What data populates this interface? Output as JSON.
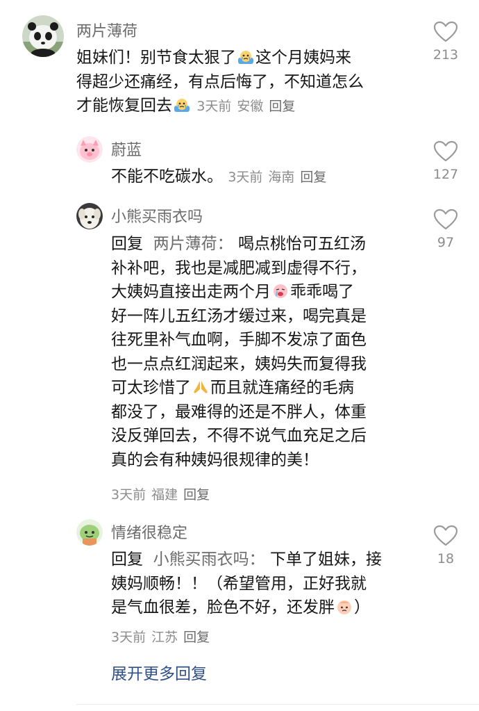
{
  "comments": [
    {
      "username": "两片薄荷",
      "avatar": "panda-avatar",
      "lines": [
        "姐妹们！别节食太狠了",
        "这个月姨妈来",
        "得超少还痛经，有点后悔了，不知道怎么",
        "才能恢复回去"
      ],
      "time": "3天前",
      "location": "安徽",
      "reply_label": "回复",
      "likes": "213"
    },
    {
      "username": "蔚蓝",
      "avatar": "cartoon-pig-avatar",
      "text": "不能不吃碳水。",
      "time": "3天前",
      "location": "海南",
      "reply_label": "回复",
      "likes": "127"
    },
    {
      "username": "小熊买雨衣吗",
      "avatar": "white-dog-avatar",
      "reply_prefix": "回复",
      "reply_target": "两片薄荷：",
      "lines": [
        "喝点桃怡可五红汤",
        "补补吧，我也是减肥减到虚得不行，",
        "大姨妈直接出走两个月",
        "乖乖喝了",
        "好一阵儿五红汤才缓过来，喝完真是",
        "往死里补气血啊，手脚不发凉了面色",
        "也一点点红润起来，姨妈失而复得我",
        "可太珍惜了",
        "而且就连痛经的毛病",
        "都没了，最难得的还是不胖人，体重",
        "没反弹回去，不得不说气血充足之后",
        "真的会有种姨妈很规律的美！"
      ],
      "time": "3天前",
      "location": "福建",
      "reply_label": "回复",
      "likes": "97"
    },
    {
      "username": "情绪很稳定",
      "avatar": "cartoon-cat-avatar",
      "reply_prefix": "回复",
      "reply_target": "小熊买雨衣吗：",
      "lines": [
        "下单了姐妹，接",
        "姨妈顺畅！！（希望管用，正好我就",
        "是气血很差，脸色不好，还发胖",
        "）"
      ],
      "time": "3天前",
      "location": "江苏",
      "reply_label": "回复",
      "likes": "18"
    }
  ],
  "expand_more": "展开更多回复",
  "colors": {
    "link": "#2f4f86",
    "meta": "#8c8c8c",
    "username": "#6b6b6b"
  }
}
